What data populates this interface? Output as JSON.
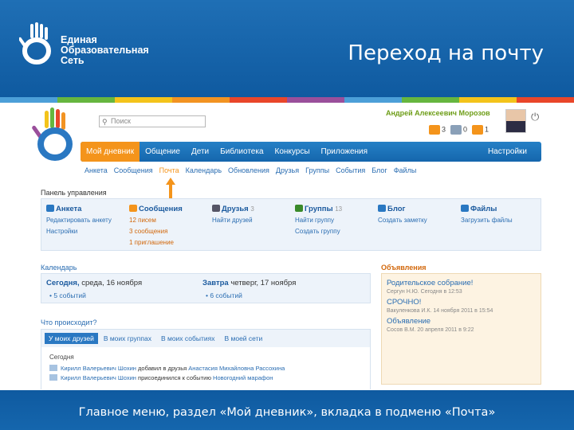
{
  "slide": {
    "brand_lines": [
      "Единая",
      "Образовательная",
      "Сеть"
    ],
    "title": "Переход на почту",
    "caption": "Главное меню, раздел «Мой дневник», вкладка в подменю «Почта»",
    "strip_colors": [
      "#4c9fd8",
      "#66b63f",
      "#f3c31b",
      "#f29322",
      "#e9462a",
      "#9a4f9b",
      "#4c9fd8",
      "#66b63f",
      "#f3c31b",
      "#e9462a"
    ]
  },
  "header": {
    "search_placeholder": "Поиск",
    "user_name": "Андрей Алексеевич Морозов",
    "counters": [
      {
        "icon": "mail-icon",
        "value": "3",
        "color": "#f4941b"
      },
      {
        "icon": "friends-icon",
        "value": "0",
        "color": "#8aa0b8"
      },
      {
        "icon": "groups-icon",
        "value": "1",
        "color": "#f4941b"
      }
    ]
  },
  "main_nav": {
    "items": [
      "Мой дневник",
      "Общение",
      "Дети",
      "Библиотека",
      "Конкурсы",
      "Приложения"
    ],
    "settings": "Настройки"
  },
  "sub_nav": {
    "items": [
      "Анкета",
      "Сообщения",
      "Почта",
      "Календарь",
      "Обновления",
      "Друзья",
      "Группы",
      "События",
      "Блог",
      "Файлы"
    ],
    "current": "Почта"
  },
  "panel": {
    "title": "Панель управления",
    "columns": [
      {
        "title": "Анкета",
        "count": "",
        "links": [
          "Редактировать анкету",
          "Настройки"
        ],
        "icon_color": "#2a78c2"
      },
      {
        "title": "Сообщения",
        "count": "",
        "links": [
          "12 писем",
          "3 сообщения",
          "1 приглашение"
        ],
        "icon_color": "#f4941b"
      },
      {
        "title": "Друзья",
        "count": "3",
        "links": [
          "Найти друзей"
        ],
        "icon_color": "#556"
      },
      {
        "title": "Группы",
        "count": "13",
        "links": [
          "Найти группу",
          "Создать группу"
        ],
        "icon_color": "#3a8a2a"
      },
      {
        "title": "Блог",
        "count": "",
        "links": [
          "Создать заметку"
        ],
        "icon_color": "#2a78c2"
      },
      {
        "title": "Файлы",
        "count": "",
        "links": [
          "Загрузить файлы"
        ],
        "icon_color": "#2a78c2"
      }
    ]
  },
  "calendar": {
    "title": "Календарь",
    "today_label": "Сегодня,",
    "today_date": "среда, 16 ноября",
    "today_events": "5 событий",
    "tomorrow_label": "Завтра",
    "tomorrow_date": "четверг, 17 ноября",
    "tomorrow_events": "6 событий"
  },
  "ads": {
    "title": "Объявления",
    "items": [
      {
        "title": "Родительское собрание!",
        "meta": "Сергун Н.Ю. Сегодня в 12:53"
      },
      {
        "title": "СРОЧНО!",
        "meta": "Вакуленкова И.К. 14 ноября 2011 в 15:54"
      },
      {
        "title": "Объявление",
        "meta": "Сосов В.М. 20 апреля 2011 в 9:22"
      }
    ]
  },
  "feed": {
    "title": "Что происходит?",
    "tabs": [
      "У моих друзей",
      "В моих группах",
      "В моих событиях",
      "В моей сети"
    ],
    "day": "Сегодня",
    "lines": [
      {
        "who": "Кирилл Валерьевич Шохин",
        "text": "добавил в друзья",
        "target": "Анастасия Михайловна Рассохина"
      },
      {
        "who": "Кирилл Валерьевич Шохин",
        "text": "присоединился к событию",
        "target": "Новогодний марафон"
      }
    ]
  }
}
